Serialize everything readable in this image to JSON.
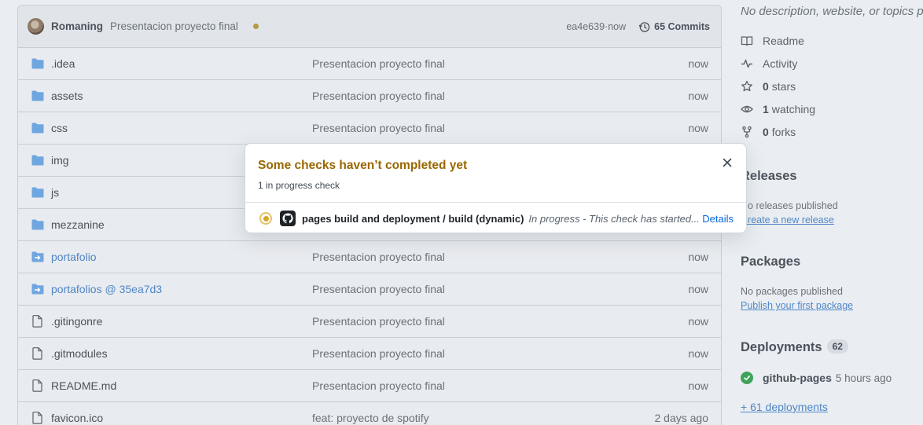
{
  "commit": {
    "author": "Romaning",
    "message": "Presentacion proyecto final",
    "hash": "ea4e639",
    "separator": " · ",
    "time": "now",
    "commits_label": "65 Commits"
  },
  "files": [
    {
      "name": ".idea",
      "type": "folder",
      "commit": "Presentacion proyecto final",
      "time": "now"
    },
    {
      "name": "assets",
      "type": "folder",
      "commit": "Presentacion proyecto final",
      "time": "now"
    },
    {
      "name": "css",
      "type": "folder",
      "commit": "Presentacion proyecto final",
      "time": "now"
    },
    {
      "name": "img",
      "type": "folder",
      "commit": "",
      "time": ""
    },
    {
      "name": "js",
      "type": "folder",
      "commit": "",
      "time": ""
    },
    {
      "name": "mezzanine",
      "type": "folder",
      "commit": "",
      "time": ""
    },
    {
      "name": "portafolio",
      "type": "submodule",
      "commit": "Presentacion proyecto final",
      "time": "now"
    },
    {
      "name": "portafolios @ 35ea7d3",
      "type": "submodule",
      "commit": "Presentacion proyecto final",
      "time": "now"
    },
    {
      "name": ".gitingonre",
      "type": "file",
      "commit": "Presentacion proyecto final",
      "time": "now"
    },
    {
      "name": ".gitmodules",
      "type": "file",
      "commit": "Presentacion proyecto final",
      "time": "now"
    },
    {
      "name": "README.md",
      "type": "file",
      "commit": "Presentacion proyecto final",
      "time": "now"
    },
    {
      "name": "favicon.ico",
      "type": "file",
      "commit": "feat: proyecto de spotify",
      "time": "2 days ago"
    }
  ],
  "sidebar": {
    "about_description": "No description, website, or topics provided.",
    "readme": "Readme",
    "activity": "Activity",
    "stars_count": "0",
    "stars_label": "stars",
    "watching_count": "1",
    "watching_label": "watching",
    "forks_count": "0",
    "forks_label": "forks",
    "releases_heading": "Releases",
    "releases_sub": "No releases published",
    "releases_link": "Create a new release",
    "packages_heading": "Packages",
    "packages_sub": "No packages published",
    "packages_link": "Publish your first package",
    "deployments_heading": "Deployments",
    "deployments_count": "62",
    "deploy_name": "github-pages",
    "deploy_time": "5 hours ago",
    "deploy_more": "+ 61 deployments"
  },
  "popover": {
    "title": "Some checks haven’t completed yet",
    "subtitle": "1 in progress check",
    "check_name": "pages build and deployment / build (dynamic)",
    "check_status": "In progress - This check has started...",
    "details_label": "Details"
  },
  "icons": {
    "folder": "folder-icon",
    "submodule": "submodule-icon",
    "file": "file-icon",
    "history": "history-icon",
    "close": "close-icon"
  },
  "colors": {
    "link": "#4f86c6",
    "warning_title": "#9a6700",
    "in_progress": "#d4a72c",
    "success": "#3fa35a"
  }
}
